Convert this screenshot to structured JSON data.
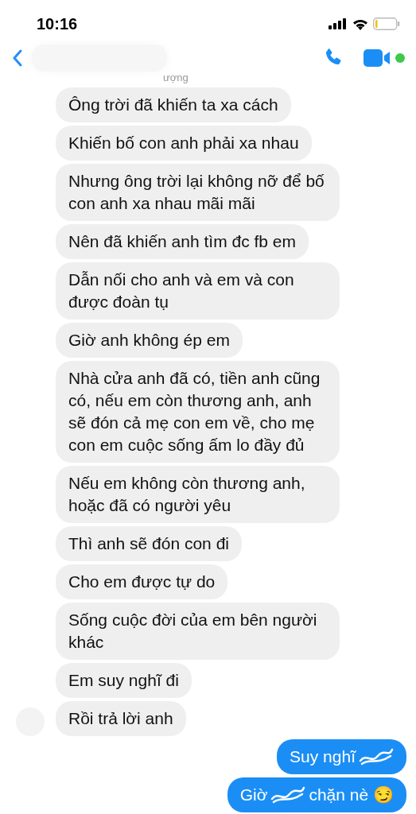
{
  "status_bar": {
    "time": "10:16"
  },
  "header": {
    "subtitle": "ượng"
  },
  "messages": [
    {
      "kind": "incoming",
      "text": "Ông trời đã khiến ta xa cách"
    },
    {
      "kind": "incoming",
      "text": "Khiến bố con anh phải xa nhau"
    },
    {
      "kind": "incoming",
      "text": "Nhưng ông trời lại không nỡ để bố con anh xa nhau mãi mãi"
    },
    {
      "kind": "incoming",
      "text": "Nên đã khiến anh tìm đc fb em"
    },
    {
      "kind": "incoming",
      "text": "Dẫn nối cho anh và em và con được đoàn tụ"
    },
    {
      "kind": "incoming",
      "text": "Giờ anh không ép em"
    },
    {
      "kind": "incoming",
      "text": "Nhà cửa anh đã có, tiền anh cũng có, nếu em còn thương anh, anh sẽ đón cả mẹ con em về, cho mẹ con em cuộc sống ấm lo đầy đủ"
    },
    {
      "kind": "incoming",
      "text": "Nếu em không còn thương anh, hoặc đã có người yêu"
    },
    {
      "kind": "incoming",
      "text": "Thì anh sẽ đón con đi"
    },
    {
      "kind": "incoming",
      "text": "Cho em được tự do"
    },
    {
      "kind": "incoming",
      "text": "Sống cuộc đời của em bên người khác"
    },
    {
      "kind": "incoming",
      "text": "Em suy nghĩ đi"
    },
    {
      "kind": "incoming",
      "text": "Rồi trả lời anh"
    },
    {
      "kind": "outgoing",
      "parts": [
        "Suy nghĩ"
      ],
      "scribbled_end": true
    },
    {
      "kind": "outgoing",
      "parts": [
        "Giờ",
        "chặn nè 😏"
      ],
      "scribbled_end": false
    }
  ]
}
